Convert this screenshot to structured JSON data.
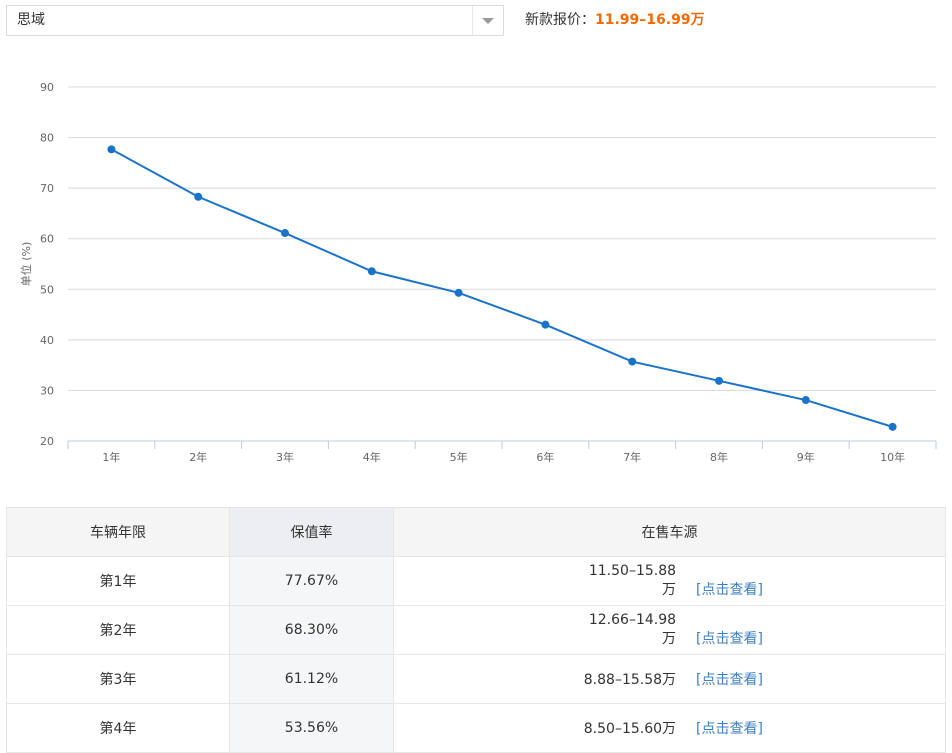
{
  "header": {
    "model_select": {
      "value": "思域"
    },
    "price_label": "新款报价：",
    "price_value": "11.99–16.99万"
  },
  "chart_data": {
    "type": "line",
    "ylabel": "单位 (%)",
    "ylim": [
      20,
      90
    ],
    "yticks": [
      20,
      30,
      40,
      50,
      60,
      70,
      80,
      90
    ],
    "categories": [
      "1年",
      "2年",
      "3年",
      "4年",
      "5年",
      "6年",
      "7年",
      "8年",
      "9年",
      "10年"
    ],
    "values": [
      77.67,
      68.3,
      61.12,
      53.56,
      49.3,
      43.0,
      35.7,
      31.9,
      28.1,
      22.8
    ],
    "grid": true,
    "line_color": "#1a73c8"
  },
  "table": {
    "headers": [
      "车辆年限",
      "保值率",
      "在售车源"
    ],
    "rows": [
      {
        "year": "第1年",
        "rate": "77.67%",
        "price": "11.50–15.88万",
        "link": "[点击查看]"
      },
      {
        "year": "第2年",
        "rate": "68.30%",
        "price": "12.66–14.98万",
        "link": "[点击查看]"
      },
      {
        "year": "第3年",
        "rate": "61.12%",
        "price": "8.88–15.58万",
        "link": "[点击查看]"
      },
      {
        "year": "第4年",
        "rate": "53.56%",
        "price": "8.50–15.60万",
        "link": "[点击查看]"
      }
    ]
  }
}
